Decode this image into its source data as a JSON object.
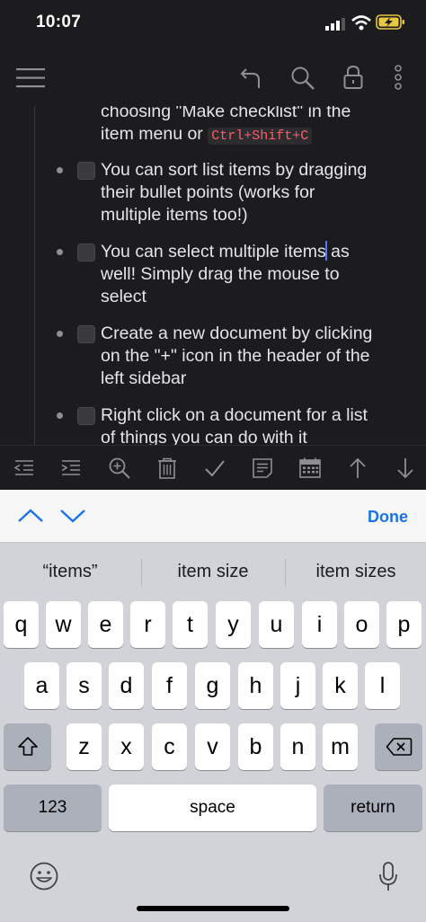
{
  "status": {
    "time": "10:07"
  },
  "header": {
    "icons": [
      "menu-icon",
      "undo-icon",
      "search-icon",
      "lock-icon",
      "more-icon"
    ]
  },
  "content": {
    "item0_line1": "choosing \"Make checklist\" in the",
    "item0_line2_prefix": "item menu or",
    "item0_shortcut": "Ctrl+Shift+C",
    "item1_line1": "You can sort list items by dragging",
    "item1_line2": "their bullet points (works for",
    "item1_line3": "multiple items too!)",
    "item2_line1_a": "You can select multiple items",
    "item2_line1_b": " as",
    "item2_line2": "well! Simply drag the mouse to",
    "item2_line3": "select",
    "item3_line1": "Create a new document by clicking",
    "item3_line2": "on the \"+\" icon in the header of the",
    "item3_line3": "left sidebar",
    "item4_line1": "Right click on a document for a list",
    "item4_line2": "of things you can do with it"
  },
  "toolbar": {
    "icons": [
      "outdent-icon",
      "indent-icon",
      "zoom-in-icon",
      "trash-icon",
      "check-icon",
      "note-icon",
      "calendar-icon",
      "move-up-icon",
      "move-down-icon"
    ]
  },
  "findbar": {
    "done_label": "Done"
  },
  "suggestions": [
    "“items”",
    "item size",
    "item sizes"
  ],
  "keyboard": {
    "row1": [
      "q",
      "w",
      "e",
      "r",
      "t",
      "y",
      "u",
      "i",
      "o",
      "p"
    ],
    "row2": [
      "a",
      "s",
      "d",
      "f",
      "g",
      "h",
      "j",
      "k",
      "l"
    ],
    "row3": [
      "z",
      "x",
      "c",
      "v",
      "b",
      "n",
      "m"
    ],
    "numbers_label": "123",
    "space_label": "space",
    "return_label": "return"
  },
  "colors": {
    "accent": "#1a73e8",
    "background": "#1c1c1e",
    "shortcut": "#ff5a6a",
    "cursor": "#4c7dff"
  }
}
